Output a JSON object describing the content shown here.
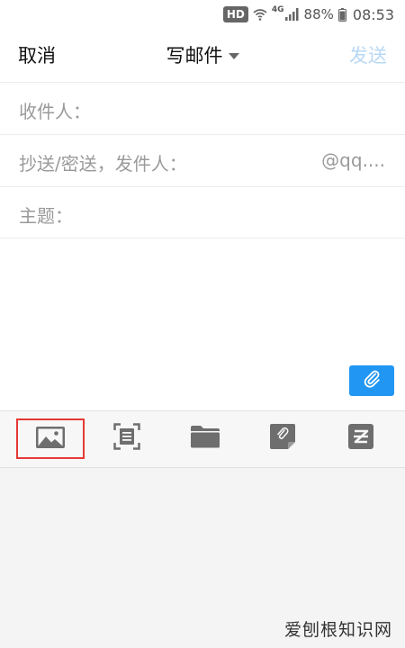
{
  "status_bar": {
    "hd": "HD",
    "network": "4G",
    "battery": "88%",
    "time": "08:53",
    "icons": [
      "wifi-icon",
      "signal-icon",
      "battery-icon"
    ]
  },
  "header": {
    "cancel": "取消",
    "title": "写邮件",
    "send": "发送"
  },
  "fields": {
    "recipient_label": "收件人：",
    "recipient_value": "",
    "cc_label": "抄送/密送，发件人：",
    "cc_value": "",
    "cc_suffix": "@qq....",
    "subject_label": "主题：",
    "subject_value": ""
  },
  "body": {
    "value": ""
  },
  "toolbar": {
    "items": [
      "image-icon",
      "scan-icon",
      "folder-icon",
      "note-icon",
      "zip-icon"
    ],
    "selected": "image-icon"
  },
  "colors": {
    "accent": "#2196f3",
    "send_disabled": "#b8d8f5",
    "highlight": "#e53935",
    "icon_gray": "#6e6e6e"
  },
  "watermark": "爱刨根知识网"
}
